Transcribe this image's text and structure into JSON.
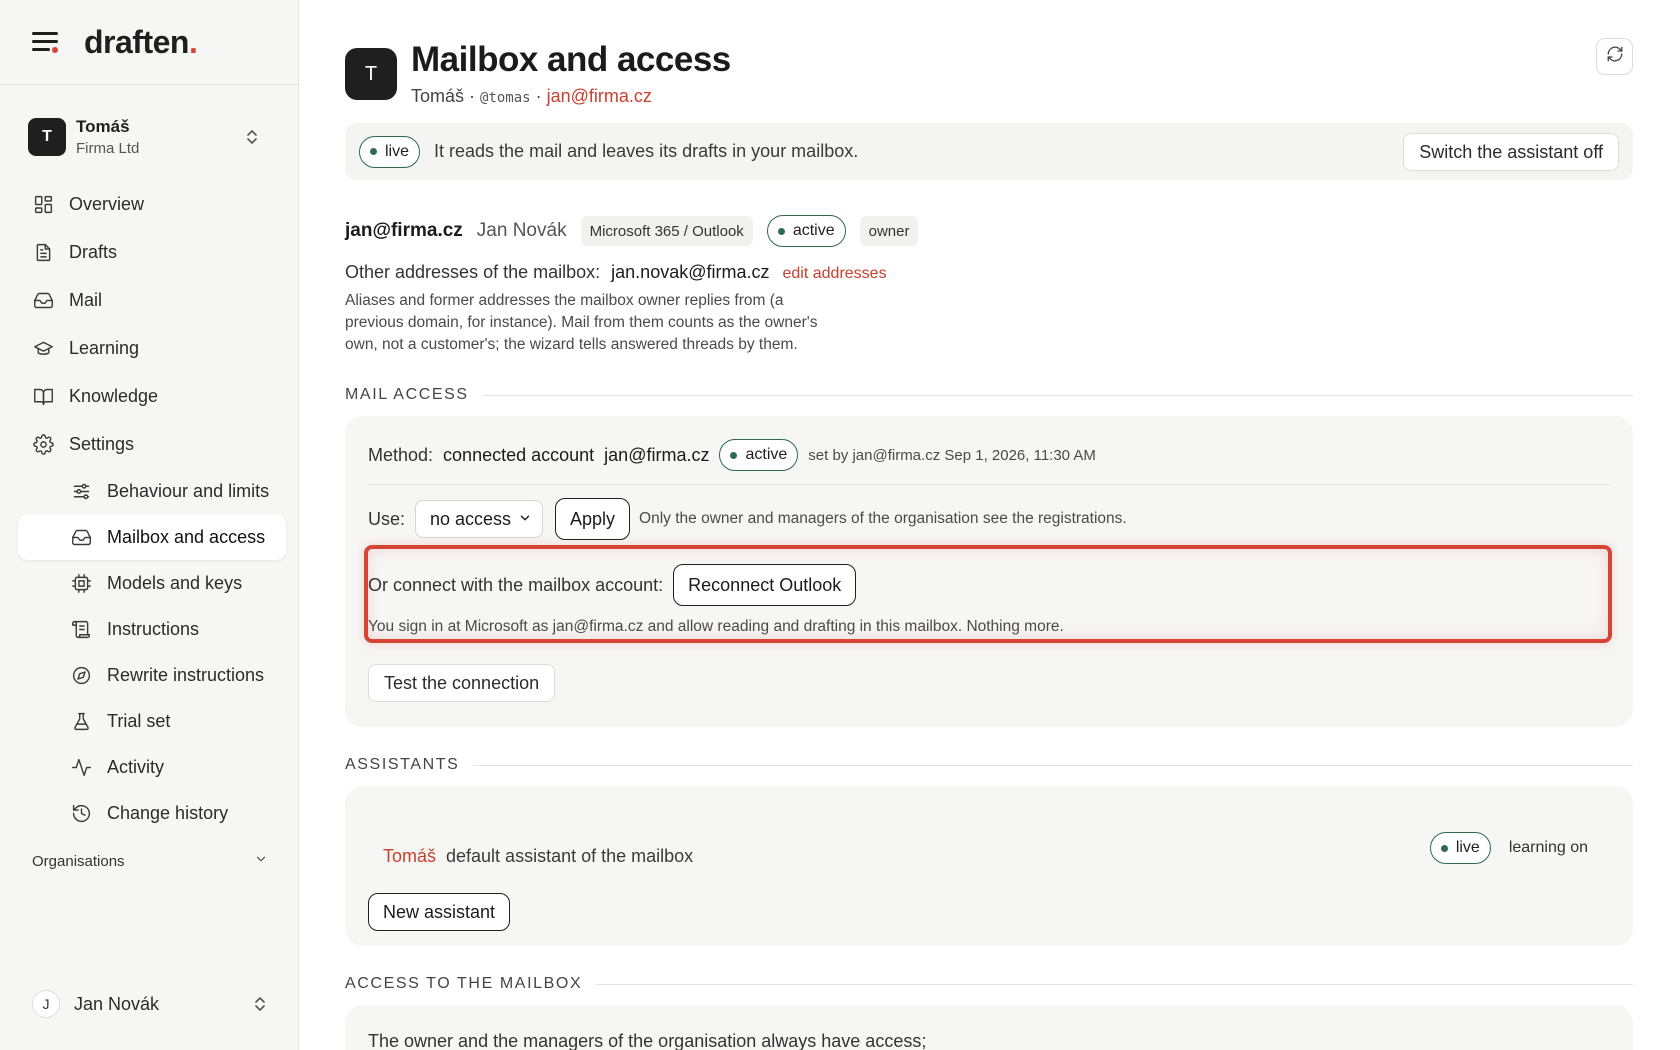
{
  "brand": {
    "name": "draften",
    "period": "."
  },
  "account": {
    "initial": "T",
    "name": "Tomáš",
    "org": "Firma Ltd"
  },
  "nav": {
    "overview": "Overview",
    "drafts": "Drafts",
    "mail": "Mail",
    "learning": "Learning",
    "knowledge": "Knowledge",
    "settings": "Settings",
    "sub": {
      "behaviour": "Behaviour and limits",
      "mailbox": "Mailbox and access",
      "models": "Models and keys",
      "instructions": "Instructions",
      "rewrite": "Rewrite instructions",
      "trial": "Trial set",
      "activity": "Activity",
      "history": "Change history"
    },
    "organisations": "Organisations"
  },
  "user": {
    "initial": "J",
    "name": "Jan Novák"
  },
  "header": {
    "initial": "T",
    "title": "Mailbox and access",
    "name": "Tomáš",
    "sep": " · ",
    "handle": "@tomas",
    "email": "jan@firma.cz"
  },
  "banner": {
    "status": "live",
    "text": "It reads the mail and leaves its drafts in your mailbox.",
    "switch_off": "Switch the assistant off"
  },
  "mailbox": {
    "email": "jan@firma.cz",
    "owner_name": "Jan Novák",
    "provider": "Microsoft 365 / Outlook",
    "status": "active",
    "role": "owner",
    "other_label": "Other addresses of the mailbox:",
    "other_value": "jan.novak@firma.cz",
    "edit_link": "edit addresses",
    "help": "Aliases and former addresses the mailbox owner replies from (a previous domain, for instance). Mail from them counts as the owner's own, not a customer's; the wizard tells answered threads by them."
  },
  "mail_access": {
    "heading": "MAIL ACCESS",
    "method_label": "Method:",
    "method_value": "connected account",
    "method_email": "jan@firma.cz",
    "method_status": "active",
    "method_meta": "set by jan@firma.cz Sep 1, 2026, 11:30 AM",
    "use_label": "Use:",
    "use_value": "no access",
    "apply": "Apply",
    "use_note": "Only the owner and managers of the organisation see the registrations.",
    "connect_label": "Or connect with the mailbox account:",
    "reconnect": "Reconnect Outlook",
    "connect_note": "You sign in at Microsoft as jan@firma.cz and allow reading and drafting in this mailbox. Nothing more.",
    "test": "Test the connection"
  },
  "assistants": {
    "heading": "ASSISTANTS",
    "items": [
      {
        "name": "Tomáš",
        "desc": "default assistant of the mailbox",
        "status": "live",
        "learning": "learning on"
      }
    ],
    "new_button": "New assistant"
  },
  "access": {
    "heading": "ACCESS TO THE MAILBOX",
    "text": "The owner and the managers of the organisation always have access;"
  },
  "colors": {
    "accent": "#d64533",
    "link": "#c8402e",
    "status_green": "#2d6b4a"
  }
}
